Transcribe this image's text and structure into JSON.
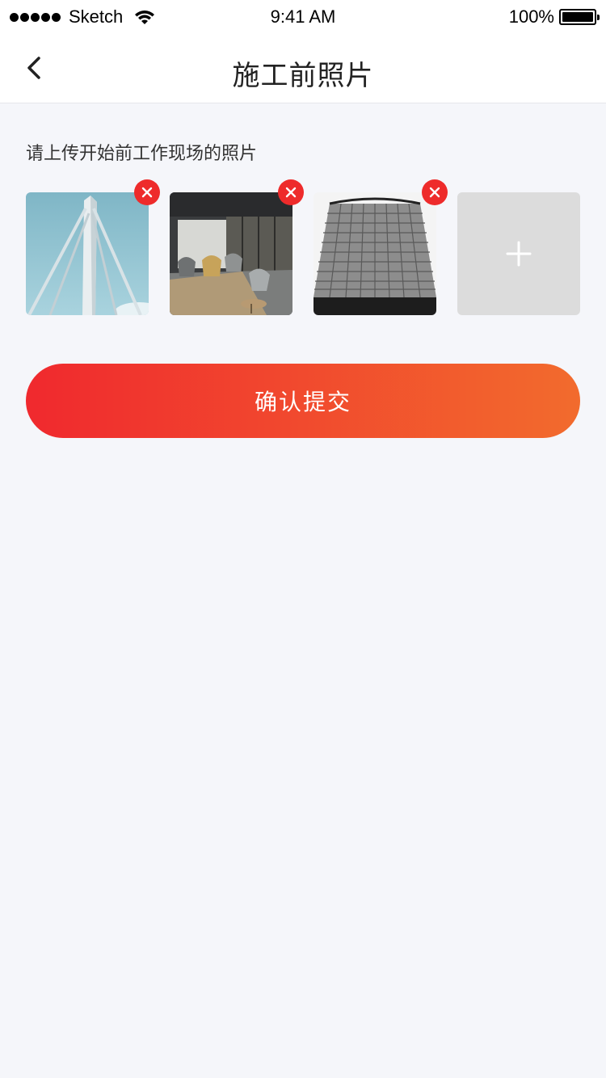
{
  "status_bar": {
    "carrier": "Sketch",
    "time": "9:41 AM",
    "battery": "100%"
  },
  "nav": {
    "title": "施工前照片",
    "back_icon": "chevron-left-icon"
  },
  "instruction": "请上传开始前工作现场的照片",
  "photos": [
    {
      "subject": "bridge-pylon",
      "remove_icon": "close-icon"
    },
    {
      "subject": "office-interior",
      "remove_icon": "close-icon"
    },
    {
      "subject": "skyscraper",
      "remove_icon": "close-icon"
    }
  ],
  "add_photo": {
    "icon": "plus-icon"
  },
  "submit_label": "确认提交",
  "colors": {
    "accent_start": "#f0292e",
    "accent_end": "#f26b2d",
    "remove_badge": "#ee2b2b",
    "page_bg": "#f5f6fa",
    "add_tile_bg": "#dcdcdc"
  }
}
